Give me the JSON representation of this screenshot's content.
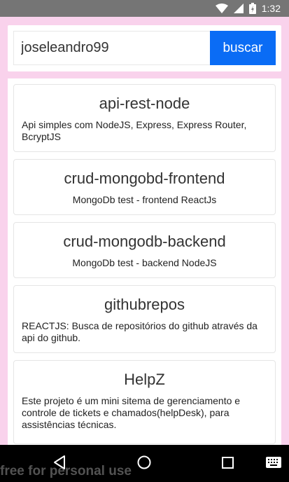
{
  "status_bar": {
    "time": "1:32",
    "icons": [
      "wifi-icon",
      "signal-icon",
      "battery-charging-icon"
    ]
  },
  "search": {
    "value": "joseleandro99",
    "button_label": "buscar"
  },
  "repos": [
    {
      "name": "api-rest-node",
      "description": "Api simples com NodeJS, Express, Express Router, BcryptJS"
    },
    {
      "name": "crud-mongobd-frontend",
      "description": "MongoDb test - frontend ReactJs"
    },
    {
      "name": "crud-mongodb-backend",
      "description": "MongoDb test - backend NodeJS"
    },
    {
      "name": "githubrepos",
      "description": "REACTJS: Busca de repositórios do github através da api do github."
    },
    {
      "name": "HelpZ",
      "description": "Este projeto é um mini sitema de gerenciamento e controle de tickets e chamados(helpDesk), para assistências técnicas."
    }
  ],
  "nav_bar": {
    "icons": [
      "back-icon",
      "home-icon",
      "recents-icon",
      "keyboard-icon"
    ]
  },
  "watermark": "free for personal use",
  "colors": {
    "background": "#f9d2ec",
    "button": "#0a6cf5",
    "status_bar": "#757575"
  }
}
